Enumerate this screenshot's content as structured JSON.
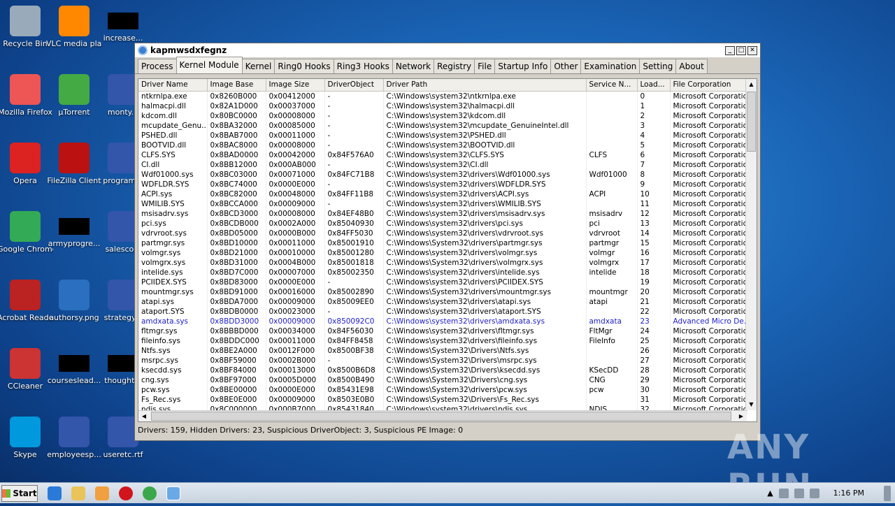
{
  "desktop": {
    "icons": [
      {
        "label": "Recycle Bin"
      },
      {
        "label": "VLC media player"
      },
      {
        "label": "increase..."
      },
      {
        "label": "Mozilla Firefox"
      },
      {
        "label": "µTorrent"
      },
      {
        "label": "monty..."
      },
      {
        "label": "Opera"
      },
      {
        "label": "FileZilla Client"
      },
      {
        "label": "program..."
      },
      {
        "label": "Google Chrome"
      },
      {
        "label": "armyprogre..."
      },
      {
        "label": "salesco..."
      },
      {
        "label": "Acrobat Reader DC"
      },
      {
        "label": "authorsy.png"
      },
      {
        "label": "strategy..."
      },
      {
        "label": "CCleaner"
      },
      {
        "label": "courseslead..."
      },
      {
        "label": "thought..."
      },
      {
        "label": "Skype"
      },
      {
        "label": "employeesp..."
      },
      {
        "label": "useretc.rtf"
      }
    ]
  },
  "window": {
    "title": "kapmwsdxfegnz",
    "tabs": [
      "Process",
      "Kernel Module",
      "Kernel",
      "Ring0 Hooks",
      "Ring3 Hooks",
      "Network",
      "Registry",
      "File",
      "Startup Info",
      "Other",
      "Examination",
      "Setting",
      "About"
    ],
    "active_tab": "Kernel Module",
    "columns": [
      "Driver Name",
      "Image Base",
      "Image Size",
      "DriverObject",
      "Driver Path",
      "Service N...",
      "Load...",
      "File Corporation"
    ],
    "rows": [
      [
        "ntkrnlpa.exe",
        "0x8260B000",
        "0x00412000",
        "-",
        "C:\\Windows\\system32\\ntkrnlpa.exe",
        "",
        "0",
        "Microsoft Corporation"
      ],
      [
        "halmacpi.dll",
        "0x82A1D000",
        "0x00037000",
        "-",
        "C:\\Windows\\system32\\halmacpi.dll",
        "",
        "1",
        "Microsoft Corporation"
      ],
      [
        "kdcom.dll",
        "0x80BC0000",
        "0x00008000",
        "-",
        "C:\\Windows\\system32\\kdcom.dll",
        "",
        "2",
        "Microsoft Corporation"
      ],
      [
        "mcupdate_Genu...",
        "0x8BA32000",
        "0x00085000",
        "-",
        "C:\\Windows\\system32\\mcupdate_GenuineIntel.dll",
        "",
        "3",
        "Microsoft Corporation"
      ],
      [
        "PSHED.dll",
        "0x8BAB7000",
        "0x00011000",
        "-",
        "C:\\Windows\\system32\\PSHED.dll",
        "",
        "4",
        "Microsoft Corporation"
      ],
      [
        "BOOTVID.dll",
        "0x8BAC8000",
        "0x00008000",
        "-",
        "C:\\Windows\\system32\\BOOTVID.dll",
        "",
        "5",
        "Microsoft Corporation"
      ],
      [
        "CLFS.SYS",
        "0x8BAD0000",
        "0x00042000",
        "0x84F576A0",
        "C:\\Windows\\system32\\CLFS.SYS",
        "CLFS",
        "6",
        "Microsoft Corporation"
      ],
      [
        "CI.dll",
        "0x8BB12000",
        "0x000AB000",
        "-",
        "C:\\Windows\\system32\\CI.dll",
        "",
        "7",
        "Microsoft Corporation"
      ],
      [
        "Wdf01000.sys",
        "0x8BC03000",
        "0x00071000",
        "0x84FC71B8",
        "C:\\Windows\\system32\\drivers\\Wdf01000.sys",
        "Wdf01000",
        "8",
        "Microsoft Corporation"
      ],
      [
        "WDFLDR.SYS",
        "0x8BC74000",
        "0x0000E000",
        "-",
        "C:\\Windows\\system32\\drivers\\WDFLDR.SYS",
        "",
        "9",
        "Microsoft Corporation"
      ],
      [
        "ACPI.sys",
        "0x8BC82000",
        "0x00048000",
        "0x84FF11B8",
        "C:\\Windows\\system32\\drivers\\ACPI.sys",
        "ACPI",
        "10",
        "Microsoft Corporation"
      ],
      [
        "WMILIB.SYS",
        "0x8BCCA000",
        "0x00009000",
        "-",
        "C:\\Windows\\system32\\drivers\\WMILIB.SYS",
        "",
        "11",
        "Microsoft Corporation"
      ],
      [
        "msisadrv.sys",
        "0x8BCD3000",
        "0x00008000",
        "0x84EF48B0",
        "C:\\Windows\\system32\\drivers\\msisadrv.sys",
        "msisadrv",
        "12",
        "Microsoft Corporation"
      ],
      [
        "pci.sys",
        "0x8BCDB000",
        "0x0002A000",
        "0x85040930",
        "C:\\Windows\\system32\\drivers\\pci.sys",
        "pci",
        "13",
        "Microsoft Corporation"
      ],
      [
        "vdrvroot.sys",
        "0x8BD05000",
        "0x0000B000",
        "0x84FF5030",
        "C:\\Windows\\system32\\drivers\\vdrvroot.sys",
        "vdrvroot",
        "14",
        "Microsoft Corporation"
      ],
      [
        "partmgr.sys",
        "0x8BD10000",
        "0x00011000",
        "0x85001910",
        "C:\\Windows\\System32\\drivers\\partmgr.sys",
        "partmgr",
        "15",
        "Microsoft Corporation"
      ],
      [
        "volmgr.sys",
        "0x8BD21000",
        "0x00010000",
        "0x85001280",
        "C:\\Windows\\system32\\drivers\\volmgr.sys",
        "volmgr",
        "16",
        "Microsoft Corporation"
      ],
      [
        "volmgrx.sys",
        "0x8BD31000",
        "0x0004B000",
        "0x85001818",
        "C:\\Windows\\System32\\drivers\\volmgrx.sys",
        "volmgrx",
        "17",
        "Microsoft Corporation"
      ],
      [
        "intelide.sys",
        "0x8BD7C000",
        "0x00007000",
        "0x85002350",
        "C:\\Windows\\system32\\drivers\\intelide.sys",
        "intelide",
        "18",
        "Microsoft Corporation"
      ],
      [
        "PCIIDEX.SYS",
        "0x8BD83000",
        "0x0000E000",
        "-",
        "C:\\Windows\\system32\\drivers\\PCIIDEX.SYS",
        "",
        "19",
        "Microsoft Corporation"
      ],
      [
        "mountmgr.sys",
        "0x8BD91000",
        "0x00016000",
        "0x85002890",
        "C:\\Windows\\System32\\drivers\\mountmgr.sys",
        "mountmgr",
        "20",
        "Microsoft Corporation"
      ],
      [
        "atapi.sys",
        "0x8BDA7000",
        "0x00009000",
        "0x85009EE0",
        "C:\\Windows\\system32\\drivers\\atapi.sys",
        "atapi",
        "21",
        "Microsoft Corporation"
      ],
      [
        "ataport.SYS",
        "0x8BDB0000",
        "0x00023000",
        "-",
        "C:\\Windows\\system32\\drivers\\ataport.SYS",
        "",
        "22",
        "Microsoft Corporation"
      ],
      [
        "amdxata.sys",
        "0x8BDD3000",
        "0x00009000",
        "0x850092C0",
        "C:\\Windows\\system32\\drivers\\amdxata.sys",
        "amdxata",
        "23",
        "Advanced Micro De..."
      ],
      [
        "fltmgr.sys",
        "0x8BBBD000",
        "0x00034000",
        "0x84F56030",
        "C:\\Windows\\system32\\drivers\\fltmgr.sys",
        "FltMgr",
        "24",
        "Microsoft Corporation"
      ],
      [
        "fileinfo.sys",
        "0x8BDDC000",
        "0x00011000",
        "0x84FF8458",
        "C:\\Windows\\system32\\drivers\\fileinfo.sys",
        "FileInfo",
        "25",
        "Microsoft Corporation"
      ],
      [
        "Ntfs.sys",
        "0x8BE2A000",
        "0x0012F000",
        "0x8500BF38",
        "C:\\Windows\\System32\\Drivers\\Ntfs.sys",
        "",
        "26",
        "Microsoft Corporation"
      ],
      [
        "msrpc.sys",
        "0x8BF59000",
        "0x0002B000",
        "-",
        "C:\\Windows\\System32\\Drivers\\msrpc.sys",
        "",
        "27",
        "Microsoft Corporation"
      ],
      [
        "ksecdd.sys",
        "0x8BF84000",
        "0x00013000",
        "0x8500B6D8",
        "C:\\Windows\\System32\\Drivers\\ksecdd.sys",
        "KSecDD",
        "28",
        "Microsoft Corporation"
      ],
      [
        "cng.sys",
        "0x8BF97000",
        "0x0005D000",
        "0x8500B490",
        "C:\\Windows\\System32\\Drivers\\cng.sys",
        "CNG",
        "29",
        "Microsoft Corporation"
      ],
      [
        "pcw.sys",
        "0x8BE00000",
        "0x0000E000",
        "0x85431E98",
        "C:\\Windows\\System32\\drivers\\pcw.sys",
        "pcw",
        "30",
        "Microsoft Corporation"
      ],
      [
        "Fs_Rec.sys",
        "0x8BE0E000",
        "0x00009000",
        "0x8503E0B0",
        "C:\\Windows\\System32\\Drivers\\Fs_Rec.sys",
        "",
        "31",
        "Microsoft Corporation"
      ],
      [
        "ndis.sys",
        "0x8C000000",
        "0x000B7000",
        "0x85431840",
        "C:\\Windows\\system32\\drivers\\ndis.sys",
        "NDIS",
        "32",
        "Microsoft Corporation"
      ]
    ],
    "highlight_row": 23,
    "highlight_color": "#2020c8",
    "status_text": "Drivers: 159, Hidden Drivers: 23, Suspicious DriverObject: 3, Suspicious PE Image: 0"
  },
  "taskbar": {
    "start_label": "Start",
    "clock": "1:16 PM"
  },
  "watermark": "ANY RUN"
}
